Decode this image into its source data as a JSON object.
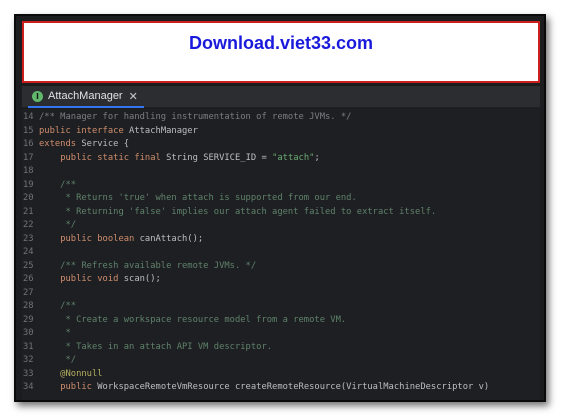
{
  "banner": {
    "text": "Download.viet33.com"
  },
  "tab": {
    "label": "AttachManager",
    "close": "✕",
    "icon": "interface-icon"
  },
  "lines": [
    {
      "n": "14",
      "parts": [
        {
          "c": "cm",
          "t": "/** Manager for handling instrumentation of remote JVMs. */"
        }
      ]
    },
    {
      "n": "15",
      "parts": [
        {
          "c": "kw",
          "t": "public interface "
        },
        {
          "c": "code",
          "t": "AttachManager"
        }
      ]
    },
    {
      "n": "16",
      "parts": [
        {
          "c": "kw",
          "t": "extends "
        },
        {
          "c": "code",
          "t": "Service {"
        }
      ]
    },
    {
      "n": "17",
      "parts": [
        {
          "c": "code",
          "t": "    "
        },
        {
          "c": "kw",
          "t": "public static final "
        },
        {
          "c": "code",
          "t": "String SERVICE_ID = "
        },
        {
          "c": "str",
          "t": "\"attach\""
        },
        {
          "c": "code",
          "t": ";"
        }
      ]
    },
    {
      "n": "18",
      "parts": []
    },
    {
      "n": "19",
      "parts": [
        {
          "c": "cmd",
          "t": "    /**"
        }
      ]
    },
    {
      "n": "20",
      "parts": [
        {
          "c": "cmd",
          "t": "     * Returns 'true' when attach is supported from our end."
        }
      ]
    },
    {
      "n": "21",
      "parts": [
        {
          "c": "cmd",
          "t": "     * Returning 'false' implies our attach agent failed to extract itself."
        }
      ]
    },
    {
      "n": "22",
      "parts": [
        {
          "c": "cmd",
          "t": "     */"
        }
      ]
    },
    {
      "n": "23",
      "parts": [
        {
          "c": "code",
          "t": "    "
        },
        {
          "c": "kw",
          "t": "public boolean "
        },
        {
          "c": "code",
          "t": "canAttach();"
        }
      ]
    },
    {
      "n": "24",
      "parts": []
    },
    {
      "n": "25",
      "parts": [
        {
          "c": "cmd",
          "t": "    /** Refresh available remote JVMs. */"
        }
      ]
    },
    {
      "n": "26",
      "parts": [
        {
          "c": "code",
          "t": "    "
        },
        {
          "c": "kw",
          "t": "public void "
        },
        {
          "c": "code",
          "t": "scan();"
        }
      ]
    },
    {
      "n": "27",
      "parts": []
    },
    {
      "n": "28",
      "parts": [
        {
          "c": "cmd",
          "t": "    /**"
        }
      ]
    },
    {
      "n": "29",
      "parts": [
        {
          "c": "cmd",
          "t": "     * Create a workspace resource model from a remote VM."
        }
      ]
    },
    {
      "n": "30",
      "parts": [
        {
          "c": "cmd",
          "t": "     *"
        }
      ]
    },
    {
      "n": "31",
      "parts": [
        {
          "c": "cmd",
          "t": "     * Takes in an attach API VM descriptor."
        }
      ]
    },
    {
      "n": "32",
      "parts": [
        {
          "c": "cmd",
          "t": "     */"
        }
      ]
    },
    {
      "n": "33",
      "parts": [
        {
          "c": "ann",
          "t": "    @Nonnull"
        }
      ]
    },
    {
      "n": "34",
      "parts": [
        {
          "c": "code",
          "t": "    "
        },
        {
          "c": "kw",
          "t": "public "
        },
        {
          "c": "code",
          "t": "WorkspaceRemoteVmResource createRemoteResource(VirtualMachineDescriptor v)"
        }
      ]
    }
  ]
}
